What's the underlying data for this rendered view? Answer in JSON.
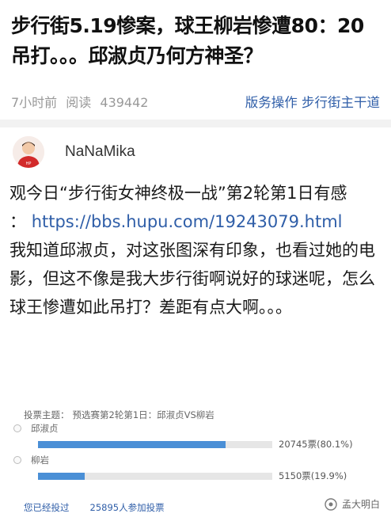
{
  "post": {
    "title": "步行街5.19惨案，球王柳岩惨遭80：20吊打。。。邱淑贞乃何方神圣？",
    "time_ago": "7小时前",
    "reads_label": "阅读",
    "reads_count": "439442",
    "breadcrumb": "版务操作 步行街主干道"
  },
  "author": {
    "name": "NaNaMika"
  },
  "body": {
    "line1": "观今日“步行街女神终极一战”第2轮第1日有感",
    "link_prefix": "：",
    "link": "https://bbs.hupu.com/19243079.html",
    "paragraph": "我知道邱淑贞，对这张图深有印象，也看过她的电影，但这不像是我大步行街啊说好的球迷呢，怎么球王惨遭如此吊打？差距有点大啊。。。"
  },
  "poll": {
    "title_label": "投票主题：",
    "title_value": "预选赛第2轮第1日：邱淑贞VS柳岩",
    "options": [
      {
        "label": "邱淑贞",
        "votes_text": "20745票(80.1%)",
        "fraction": 0.801
      },
      {
        "label": "柳岩",
        "votes_text": "5150票(19.9%)",
        "fraction": 0.199
      }
    ],
    "voted_text": "您已经投过",
    "participants": "25895人参加投票"
  },
  "watermark": {
    "text": "孟大明白",
    "icon": "wechat-official-account-icon"
  },
  "colors": {
    "link": "#2f5ea8",
    "bar_fill": "#4a8fd6",
    "bar_track": "#e6e6e6",
    "muted": "#999999"
  }
}
